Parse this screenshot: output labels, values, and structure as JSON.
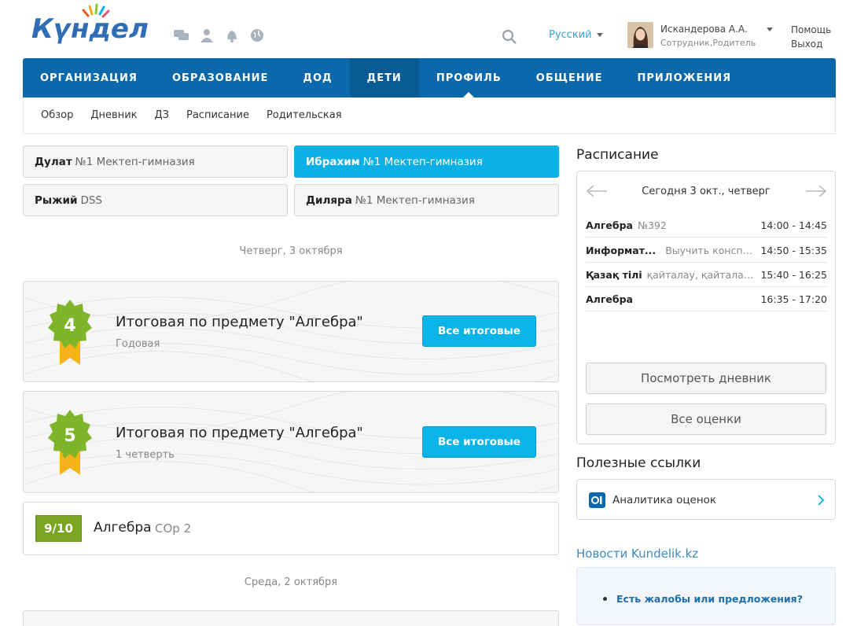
{
  "header": {
    "logo_text": "Күнделік",
    "language": "Русский",
    "user_name": "Искандерова А.А.",
    "user_roles": "Сотрудник,Родитель",
    "help": "Помощь",
    "exit": "Выход"
  },
  "nav": {
    "items": [
      "ОРГАНИЗАЦИЯ",
      "ОБРАЗОВАНИЕ",
      "ДОД",
      "ДЕТИ",
      "ПРОФИЛЬ",
      "ОБЩЕНИЕ",
      "ПРИЛОЖЕНИЯ"
    ],
    "active": "ДЕТИ"
  },
  "subnav": {
    "items": [
      "Обзор",
      "Дневник",
      "ДЗ",
      "Расписание",
      "Родительская"
    ]
  },
  "children": [
    {
      "name": "Дулат",
      "school": "№1 Мектеп-гимназия",
      "selected": false
    },
    {
      "name": "Ибрахим",
      "school": "№1 Мектеп-гимназия",
      "selected": true
    },
    {
      "name": "Рыжий",
      "school": "DSS",
      "selected": false
    },
    {
      "name": "Диляра",
      "school": "№1 Мектеп-гимназия",
      "selected": false
    }
  ],
  "feed": {
    "date1": "Четверг, 3 октября",
    "date2": "Среда, 2 октября",
    "cards": [
      {
        "mark": "4",
        "title": "Итоговая по предмету \"Алгебра\"",
        "period": "Годовая",
        "button": "Все итоговые"
      },
      {
        "mark": "5",
        "title": "Итоговая по предмету \"Алгебра\"",
        "period": "1 четверть",
        "button": "Все итоговые"
      }
    ],
    "mark_row": {
      "grade": "9/10",
      "subject": "Алгебра",
      "work": "СОр 2"
    }
  },
  "schedule": {
    "title": "Расписание",
    "date": "Сегодня 3 окт., четверг",
    "lessons": [
      {
        "name": "Алгебра",
        "homework": "№392",
        "time": "14:00 - 14:45"
      },
      {
        "name": "Информат...",
        "homework": "Выучить конспек...",
        "time": "14:50 - 15:35"
      },
      {
        "name": "Қазақ тілі",
        "homework": "қайталау, қайталау; қ...",
        "time": "15:40 - 16:25"
      },
      {
        "name": "Алгебра",
        "homework": "",
        "time": "16:35 - 17:20"
      }
    ],
    "diary_button": "Посмотреть дневник",
    "marks_button": "Все оценки"
  },
  "links": {
    "title": "Полезные ссылки",
    "item": "Аналитика оценок"
  },
  "news": {
    "title": "Новости Kundelik.kz",
    "item": "Есть жалобы или предложения?"
  },
  "colors": {
    "nav": "#0a68ab",
    "accent": "#0db0e6",
    "grade": "#7aa520"
  }
}
